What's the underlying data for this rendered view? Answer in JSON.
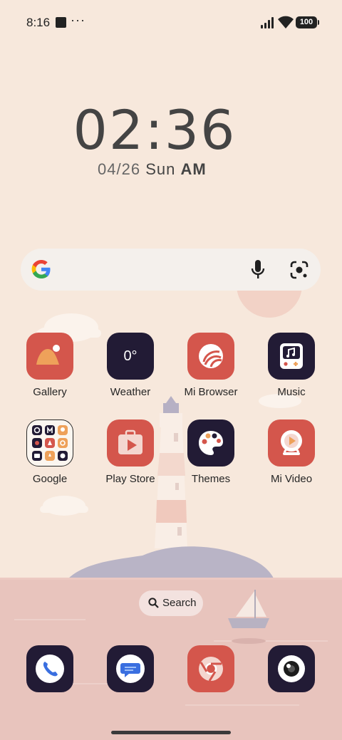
{
  "status_bar": {
    "time": "8:16",
    "more": "···",
    "battery": "100"
  },
  "clock_widget": {
    "time": "02:36",
    "date": "04/26",
    "day": "Sun",
    "meridiem": "AM"
  },
  "google_search": {
    "logo": "google-g-logo",
    "mic_icon": "microphone-icon",
    "lens_icon": "google-lens-icon"
  },
  "apps": [
    {
      "label": "Gallery",
      "icon": "gallery-icon"
    },
    {
      "label": "Weather",
      "icon": "weather-icon",
      "badge": "0°"
    },
    {
      "label": "Mi Browser",
      "icon": "mi-browser-icon"
    },
    {
      "label": "Music",
      "icon": "music-icon"
    },
    {
      "label": "Google",
      "icon": "google-folder-icon"
    },
    {
      "label": "Play Store",
      "icon": "play-store-icon"
    },
    {
      "label": "Themes",
      "icon": "themes-icon"
    },
    {
      "label": "Mi Video",
      "icon": "mi-video-icon"
    }
  ],
  "search_pill": {
    "label": "Search"
  },
  "dock": [
    {
      "icon": "phone-icon"
    },
    {
      "icon": "messages-icon"
    },
    {
      "icon": "chrome-icon"
    },
    {
      "icon": "camera-icon"
    }
  ],
  "colors": {
    "background": "#f7e8dc",
    "icon_red": "#d4564c",
    "icon_navy": "#221b35",
    "sea": "#e8c4bd"
  }
}
